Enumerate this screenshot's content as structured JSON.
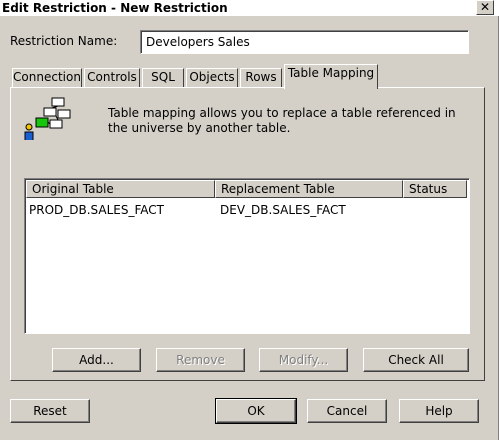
{
  "window": {
    "title": "Edit Restriction - New Restriction",
    "close_glyph": "✕"
  },
  "form": {
    "name_label": "Restriction Name:",
    "name_value": "Developers Sales"
  },
  "tabs": [
    {
      "label": "Connection"
    },
    {
      "label": "Controls"
    },
    {
      "label": "SQL"
    },
    {
      "label": "Objects"
    },
    {
      "label": "Rows"
    },
    {
      "label": "Table Mapping"
    }
  ],
  "active_tab": "Table Mapping",
  "panel": {
    "icon": "table-mapping-icon",
    "description": "Table mapping allows you to replace a table referenced in the universe by another table.",
    "table": {
      "columns": [
        "Original Table",
        "Replacement Table",
        "Status"
      ],
      "rows": [
        {
          "original": "PROD_DB.SALES_FACT",
          "replacement": "DEV_DB.SALES_FACT",
          "status": ""
        }
      ]
    },
    "buttons": {
      "add": "Add...",
      "remove": "Remove",
      "modify": "Modify...",
      "check_all": "Check All"
    }
  },
  "footer": {
    "reset": "Reset",
    "ok": "OK",
    "cancel": "Cancel",
    "help": "Help"
  },
  "colors": {
    "face": "#d4d0c8",
    "highlight": "#ffffff",
    "shadow": "#808080",
    "dark_shadow": "#404040",
    "icon_green": "#16c60c"
  }
}
